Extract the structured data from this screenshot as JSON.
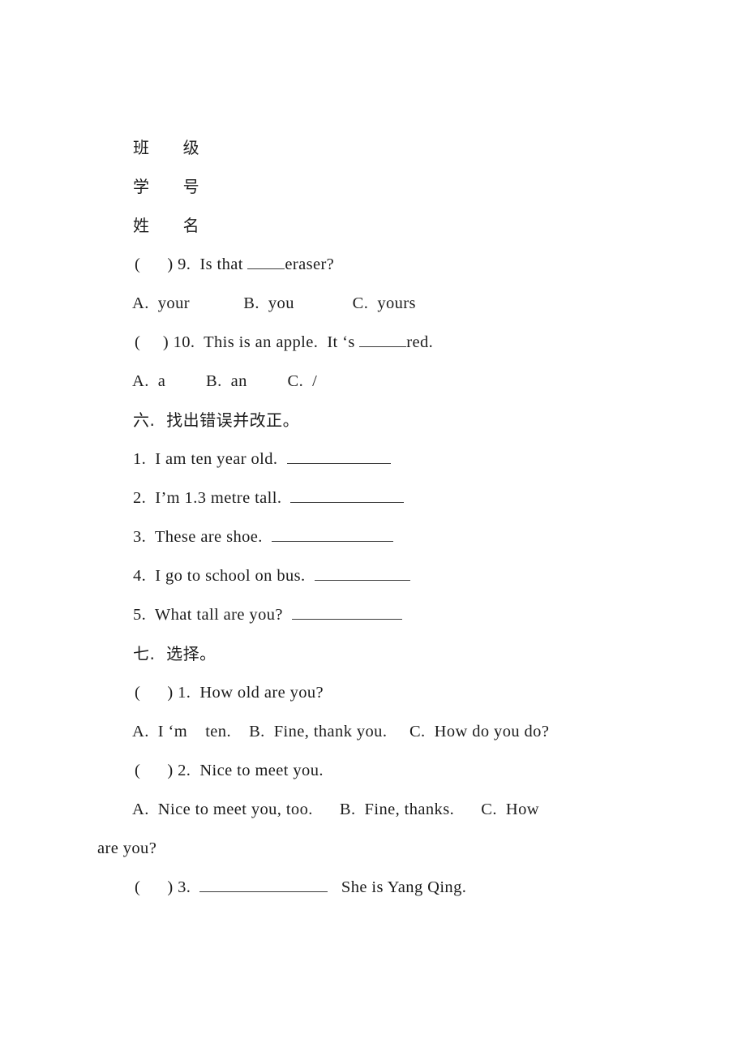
{
  "document": {
    "type": "worksheet",
    "language": "zh-CN/en",
    "header_fields": [
      {
        "label": "班      级"
      },
      {
        "label": "学      号"
      },
      {
        "label": "姓      名"
      }
    ],
    "lines": {
      "q9_stem_pre": "(      ) 9.  Is that ",
      "q9_stem_post": "eraser?",
      "q9_options": "A.  your            B.  you             C.  yours",
      "q10_stem_pre": "(     ) 10.  This is an apple.  It ‘s ",
      "q10_stem_post": "red.",
      "q10_options": "A.  a         B.  an         C.  /",
      "section6_title": "六.  找出错误并改正。",
      "s6_q1_pre": "1.  I am ten year old.  ",
      "s6_q2_pre": "2.  I’m 1.3 metre tall.  ",
      "s6_q3_pre": "3.  These are shoe.  ",
      "s6_q4_pre": "4.  I go to school on bus.  ",
      "s6_q5_pre": "5.  What tall are you?  ",
      "section7_title": "七.  选择。",
      "s7_q1_stem": "(      ) 1.  How old are you?",
      "s7_q1_options": "A.  I ‘m    ten.    B.  Fine, thank you.     C.  How do you do?",
      "s7_q2_stem": "(      ) 2.  Nice to meet you.",
      "s7_q2_options": "A.  Nice to meet you, too.      B.  Fine, thanks.      C.  How",
      "s7_q2_options_wrap": "are you?",
      "s7_q3_pre": "(      ) 3.  ",
      "s7_q3_post": "   She is Yang Qing."
    }
  },
  "colors": {
    "page_background": "#ffffff",
    "text": "#1d1d1d",
    "rule": "#3a3a3a"
  }
}
